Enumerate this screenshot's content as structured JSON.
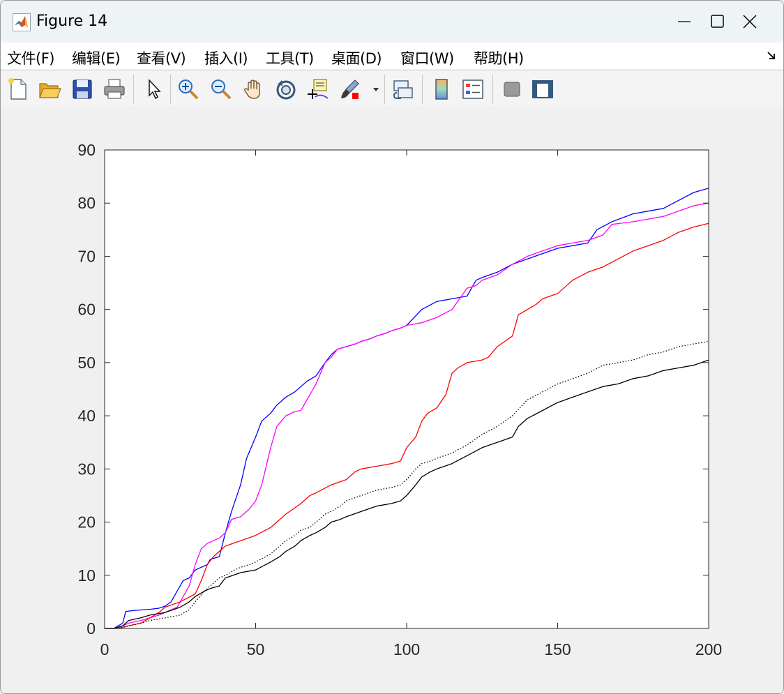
{
  "window": {
    "title": "Figure 14",
    "controls": {
      "minimize": "minimize-icon",
      "maximize": "maximize-icon",
      "close": "close-icon"
    }
  },
  "menu": {
    "items": [
      {
        "label": "文件(F)",
        "key": "F"
      },
      {
        "label": "编辑(E)",
        "key": "E"
      },
      {
        "label": "查看(V)",
        "key": "V"
      },
      {
        "label": "插入(I)",
        "key": "I"
      },
      {
        "label": "工具(T)",
        "key": "T"
      },
      {
        "label": "桌面(D)",
        "key": "D"
      },
      {
        "label": "窗口(W)",
        "key": "W"
      },
      {
        "label": "帮助(H)",
        "key": "H"
      }
    ]
  },
  "toolbar": {
    "buttons": [
      "new-figure-icon",
      "open-file-icon",
      "save-icon",
      "print-icon",
      "pointer-icon",
      "zoom-in-icon",
      "zoom-out-icon",
      "pan-hand-icon",
      "rotate-3d-icon",
      "data-cursor-icon",
      "brush-icon",
      "link-plot-icon",
      "colorbar-icon",
      "legend-icon",
      "hide-plot-tools-icon",
      "show-plot-tools-icon"
    ]
  },
  "chart_data": {
    "type": "line",
    "xlim": [
      0,
      200
    ],
    "ylim": [
      0,
      90
    ],
    "xticks": [
      0,
      50,
      100,
      150,
      200
    ],
    "yticks": [
      0,
      10,
      20,
      30,
      40,
      50,
      60,
      70,
      80,
      90
    ],
    "xtick_labels": [
      "0",
      "50",
      "100",
      "150",
      "200"
    ],
    "ytick_labels": [
      "0",
      "10",
      "20",
      "30",
      "40",
      "50",
      "60",
      "70",
      "80",
      "90"
    ],
    "grid": false,
    "series": [
      {
        "color": "#0000ff",
        "style": "solid",
        "x": [
          0,
          3,
          6,
          7,
          10,
          15,
          18,
          20,
          22,
          24,
          26,
          28,
          30,
          34,
          35,
          38,
          40,
          42,
          45,
          47,
          50,
          52,
          55,
          57,
          60,
          63,
          65,
          67,
          70,
          73,
          75,
          77,
          80,
          83,
          85,
          88,
          90,
          93,
          95,
          98,
          100,
          105,
          110,
          115,
          120,
          123,
          125,
          130,
          135,
          140,
          145,
          150,
          155,
          160,
          163,
          168,
          175,
          180,
          185,
          190,
          195,
          200
        ],
        "y": [
          0,
          0,
          1,
          3.2,
          3.4,
          3.6,
          3.8,
          4.2,
          5,
          7,
          9,
          9.5,
          11,
          12,
          13,
          13.5,
          18,
          22,
          27,
          32,
          36,
          39,
          40.5,
          42,
          43.5,
          44.5,
          45.5,
          46.5,
          47.5,
          50,
          51.5,
          52.5,
          53,
          53.5,
          54,
          54.5,
          55,
          55.5,
          56,
          56.5,
          57,
          60,
          61.5,
          62,
          62.5,
          65.5,
          66,
          67,
          68.5,
          69.5,
          70.5,
          71.5,
          72,
          72.5,
          75,
          76.5,
          78,
          78.5,
          79,
          80.5,
          82,
          82.8
        ]
      },
      {
        "color": "#ff00ff",
        "style": "solid",
        "x": [
          0,
          3,
          6,
          8,
          12,
          15,
          18,
          20,
          22,
          24,
          26,
          28,
          30,
          32,
          34,
          36,
          38,
          40,
          42,
          45,
          48,
          50,
          52,
          55,
          57,
          60,
          63,
          65,
          67,
          70,
          73,
          75,
          77,
          80,
          83,
          85,
          88,
          90,
          93,
          95,
          98,
          100,
          105,
          110,
          115,
          120,
          123,
          125,
          130,
          135,
          140,
          145,
          150,
          155,
          160,
          165,
          168,
          175,
          180,
          185,
          190,
          195,
          200
        ],
        "y": [
          0,
          0,
          0.5,
          1,
          1.5,
          2,
          2.5,
          3,
          3.5,
          4,
          6,
          8,
          12,
          15,
          16,
          16.5,
          17,
          18,
          20.5,
          21,
          22.5,
          24,
          27,
          34,
          38,
          40,
          40.8,
          41,
          43,
          46,
          50,
          51,
          52.5,
          53,
          53.5,
          54,
          54.5,
          55,
          55.5,
          56,
          56.5,
          57,
          57.5,
          58.5,
          60,
          64,
          64.5,
          65.5,
          66.5,
          68.5,
          70,
          71,
          72,
          72.5,
          73,
          74,
          76,
          76.5,
          77,
          77.5,
          78.5,
          79.5,
          80
        ]
      },
      {
        "color": "#ff0000",
        "style": "solid",
        "x": [
          0,
          4,
          8,
          12,
          15,
          18,
          20,
          25,
          30,
          32,
          34,
          36,
          38,
          40,
          45,
          50,
          55,
          60,
          65,
          68,
          70,
          75,
          80,
          83,
          85,
          90,
          95,
          98,
          100,
          103,
          105,
          107,
          110,
          113,
          115,
          117,
          120,
          125,
          127,
          130,
          135,
          137,
          140,
          143,
          145,
          150,
          155,
          160,
          165,
          170,
          175,
          180,
          185,
          190,
          195,
          200
        ],
        "y": [
          0,
          0,
          0.5,
          1,
          2,
          3,
          4,
          5,
          6.5,
          9,
          12,
          13.5,
          14.5,
          15.5,
          16.5,
          17.5,
          19,
          21.5,
          23.5,
          25,
          25.5,
          27,
          28,
          29.5,
          30,
          30.5,
          31,
          31.5,
          34,
          36,
          39,
          40.5,
          41.5,
          44,
          48,
          49,
          50,
          50.5,
          51,
          53,
          55,
          59,
          60,
          61,
          62,
          63,
          65.5,
          67,
          68,
          69.5,
          71,
          72,
          73,
          74.5,
          75.5,
          76.2
        ]
      },
      {
        "color": "#000000",
        "style": "dotted",
        "x": [
          0,
          5,
          8,
          12,
          15,
          20,
          25,
          28,
          30,
          33,
          35,
          38,
          40,
          43,
          45,
          48,
          50,
          55,
          58,
          60,
          63,
          65,
          68,
          70,
          73,
          75,
          78,
          80,
          85,
          90,
          95,
          98,
          100,
          103,
          105,
          108,
          110,
          115,
          120,
          125,
          130,
          135,
          140,
          145,
          150,
          155,
          160,
          165,
          170,
          175,
          180,
          185,
          190,
          195,
          200
        ],
        "y": [
          0,
          0,
          0.5,
          1,
          1.5,
          2,
          2.5,
          3.5,
          5,
          7,
          8,
          9.5,
          10,
          11,
          11.5,
          12,
          12.5,
          14,
          15.5,
          16.5,
          17.5,
          18.5,
          19,
          20,
          21.5,
          22,
          23,
          24,
          25,
          26,
          26.5,
          27,
          28,
          30,
          31,
          31.5,
          32,
          33,
          34.5,
          36.5,
          38,
          40,
          43,
          44.5,
          46,
          47,
          48,
          49.5,
          50,
          50.5,
          51.5,
          52,
          53,
          53.5,
          54
        ]
      },
      {
        "color": "#000000",
        "style": "solid",
        "x": [
          0,
          3,
          6,
          8,
          12,
          15,
          20,
          25,
          28,
          30,
          33,
          35,
          38,
          40,
          45,
          50,
          55,
          58,
          60,
          63,
          65,
          68,
          70,
          73,
          75,
          78,
          80,
          85,
          90,
          95,
          98,
          100,
          103,
          105,
          108,
          110,
          115,
          120,
          125,
          130,
          135,
          137,
          140,
          145,
          150,
          155,
          160,
          165,
          170,
          175,
          180,
          185,
          190,
          195,
          200
        ],
        "y": [
          0,
          0,
          0.5,
          1.5,
          2,
          2.5,
          3,
          4,
          5,
          6,
          7,
          7.5,
          8,
          9.5,
          10.5,
          11,
          12.5,
          13.5,
          14.5,
          15.5,
          16.5,
          17.5,
          18,
          19,
          20,
          20.5,
          21,
          22,
          23,
          23.5,
          24,
          25,
          27,
          28.5,
          29.5,
          30,
          31,
          32.5,
          34,
          35,
          36,
          38,
          39.5,
          41,
          42.5,
          43.5,
          44.5,
          45.5,
          46,
          47,
          47.5,
          48.5,
          49,
          49.5,
          50.5
        ]
      }
    ]
  }
}
